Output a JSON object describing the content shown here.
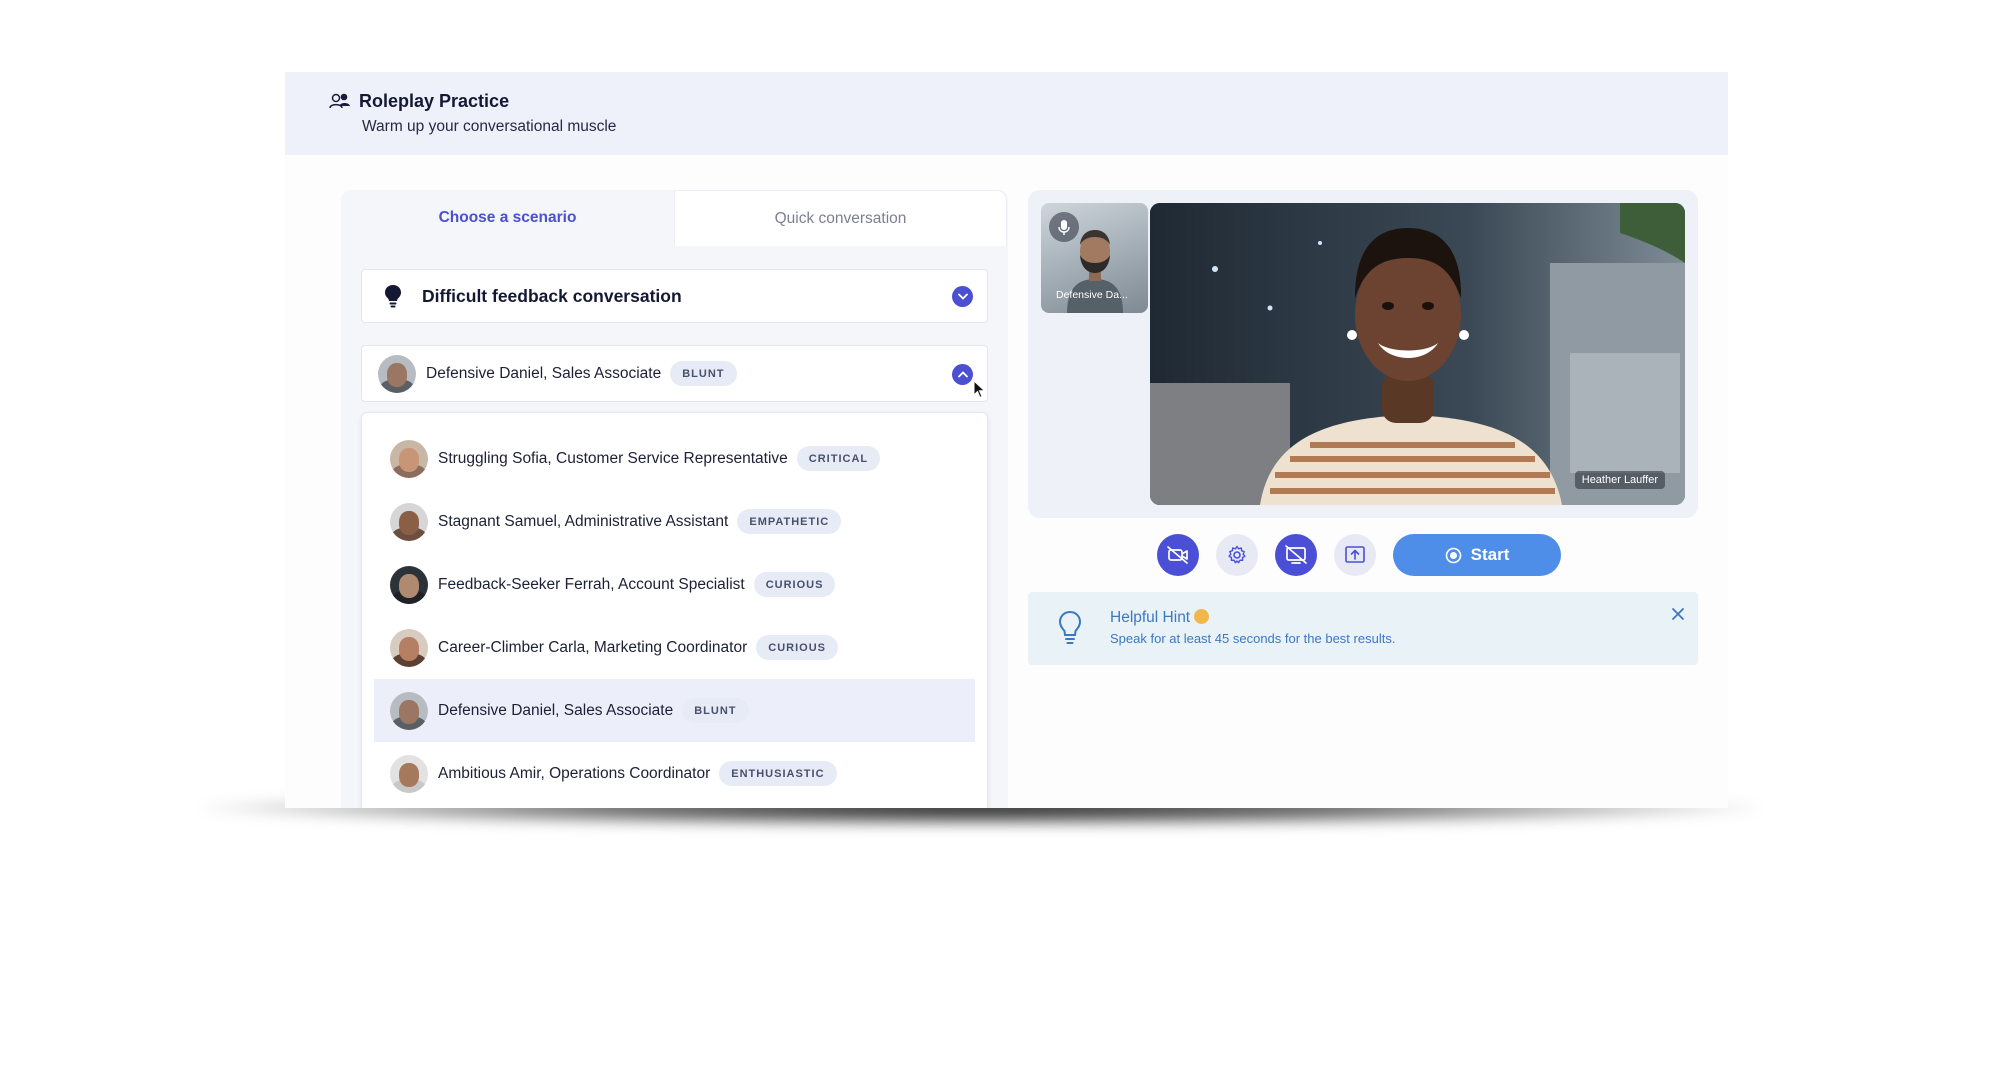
{
  "header": {
    "title": "Roleplay Practice",
    "subtitle": "Warm up your conversational muscle"
  },
  "tabs": [
    {
      "label": "Choose a scenario",
      "active": true
    },
    {
      "label": "Quick conversation",
      "active": false
    }
  ],
  "scenario": {
    "selected": "Difficult feedback conversation",
    "icon": "lightbulb-icon"
  },
  "persona_select": {
    "name": "Defensive Daniel, Sales Associate",
    "tag": "BLUNT",
    "icon": "chevron-up-icon"
  },
  "personas": [
    {
      "name": "Struggling Sofia, Customer Service Representative",
      "tag": "CRITICAL"
    },
    {
      "name": "Stagnant Samuel, Administrative Assistant",
      "tag": "EMPATHETIC"
    },
    {
      "name": "Feedback-Seeker Ferrah, Account Specialist",
      "tag": "CURIOUS"
    },
    {
      "name": "Career-Climber Carla, Marketing Coordinator",
      "tag": "CURIOUS"
    },
    {
      "name": "Defensive Daniel, Sales Associate",
      "tag": "BLUNT",
      "selected": true
    },
    {
      "name": "Ambitious Amir, Operations Coordinator",
      "tag": "ENTHUSIASTIC"
    }
  ],
  "video": {
    "thumbnail_label": "Defensive Da...",
    "main_label": "Heather Lauffer"
  },
  "controls": {
    "start_label": "Start",
    "icons": [
      "camera-off-icon",
      "settings-icon",
      "screen-share-off-icon",
      "upload-icon",
      "record-icon"
    ]
  },
  "hint": {
    "title": "Helpful Hint",
    "body": "Speak for at least 45 seconds for the best results."
  },
  "colors": {
    "accent": "#4a4fd6",
    "start_button": "#4e8ee9",
    "header_bg": "#eef0fa",
    "hint_bg": "#e8f2f7",
    "hint_text": "#3c78c0",
    "selected_row": "#eceff9"
  }
}
